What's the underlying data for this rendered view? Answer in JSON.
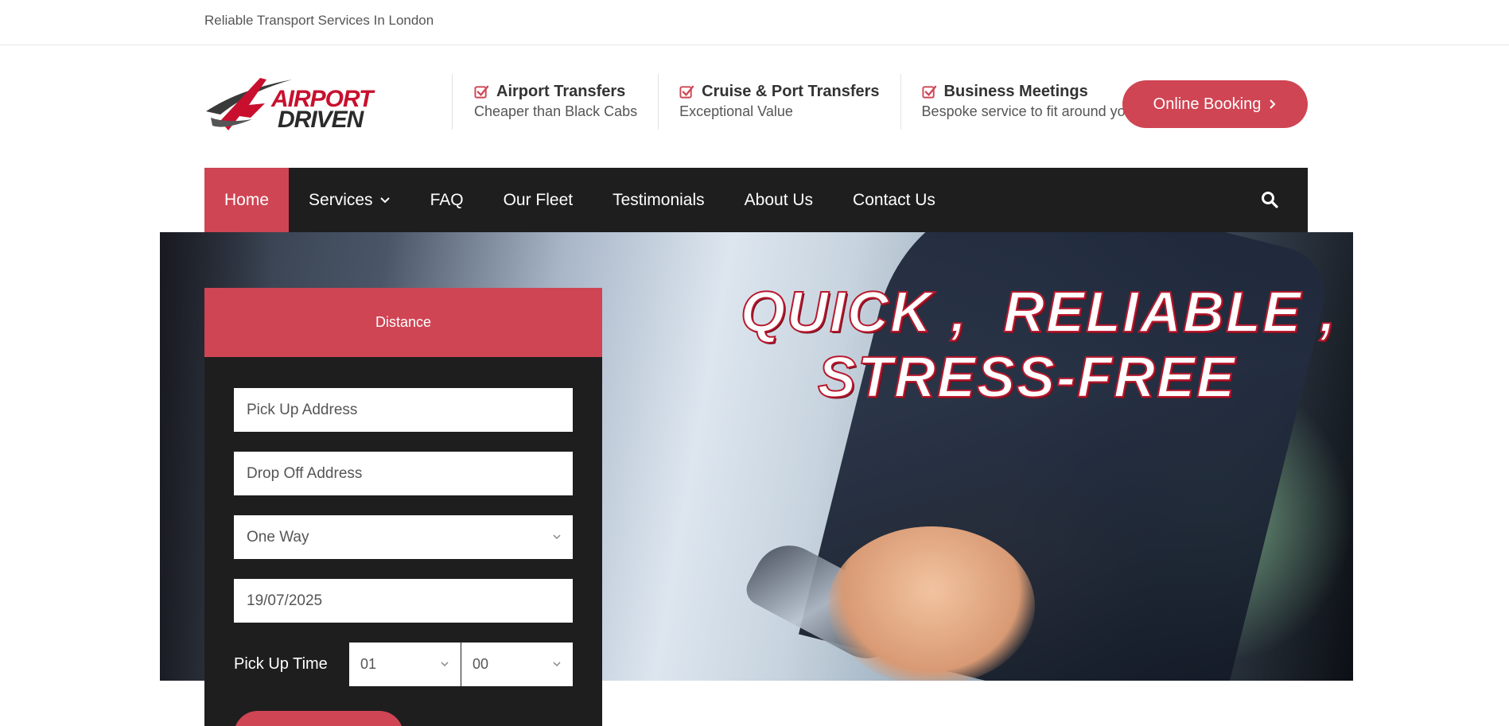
{
  "topbar": {
    "tagline": "Reliable Transport Services In London"
  },
  "logo": {
    "line1": "AIRPORT",
    "line2": "DRIVEN"
  },
  "features": [
    {
      "title": "Airport Transfers",
      "subtitle": "Cheaper than Black Cabs",
      "icon": "checkbox-icon"
    },
    {
      "title": "Cruise & Port Transfers",
      "subtitle": "Exceptional Value",
      "icon": "checkbox-icon"
    },
    {
      "title": "Business Meetings",
      "subtitle": "Bespoke service to fit around you",
      "icon": "checkbox-icon"
    }
  ],
  "header": {
    "booking_label": "Online Booking",
    "booking_icon": "chevron-right-icon"
  },
  "nav": {
    "items": [
      {
        "label": "Home",
        "active": true
      },
      {
        "label": "Services",
        "has_dropdown": true
      },
      {
        "label": "FAQ"
      },
      {
        "label": "Our Fleet"
      },
      {
        "label": "Testimonials"
      },
      {
        "label": "About Us"
      },
      {
        "label": "Contact Us"
      }
    ],
    "search_icon": "search-icon"
  },
  "hero": {
    "headline_line1": "QUICK ,  RELIABLE ,",
    "headline_line2": "STRESS-FREE"
  },
  "form": {
    "tab_label": "Distance",
    "pickup_placeholder": "Pick Up Address",
    "dropoff_placeholder": "Drop Off Address",
    "trip_type": "One Way",
    "date": "19/07/2025",
    "time_label": "Pick Up Time",
    "hour": "01",
    "minute": "00"
  },
  "colors": {
    "accent": "#cf4554",
    "nav_bg": "#1e1e1e"
  }
}
